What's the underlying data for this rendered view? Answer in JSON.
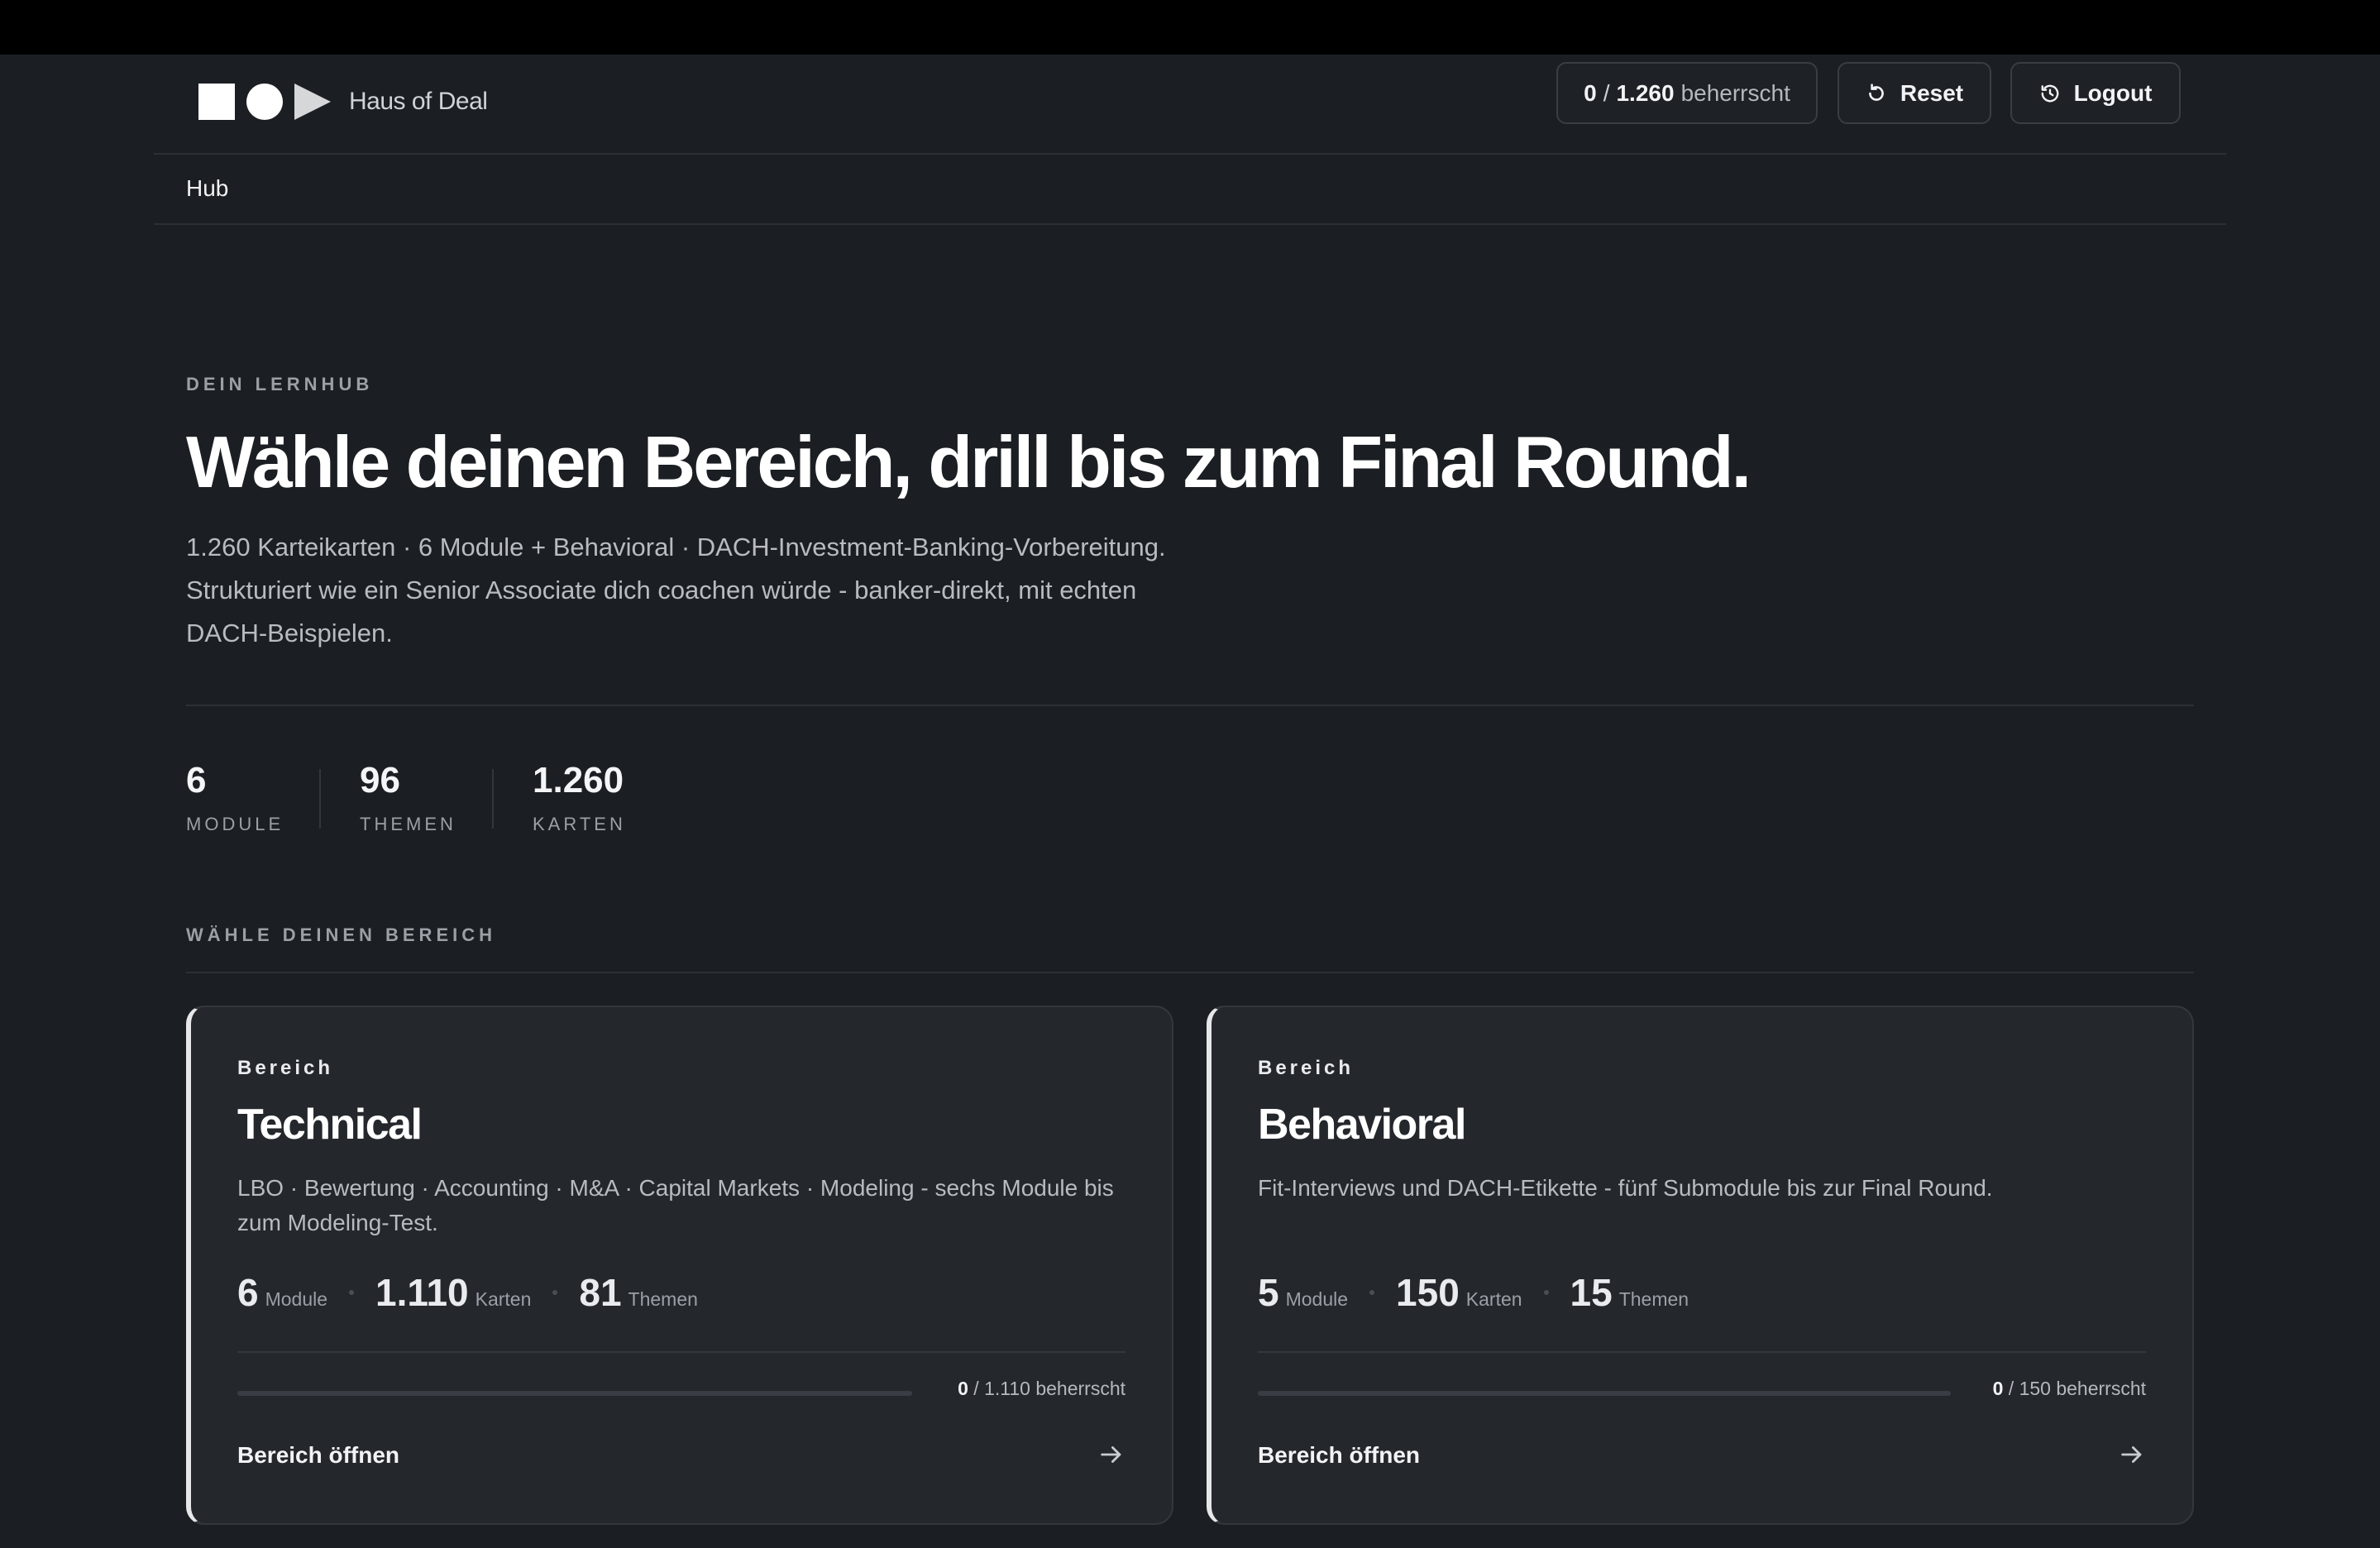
{
  "app": {
    "name": "Haus of Deal",
    "mastery": {
      "current": "0",
      "separator": "/",
      "total": "1.260",
      "suffix": "beherrscht"
    },
    "reset_label": "Reset",
    "logout_label": "Logout"
  },
  "nav": {
    "hub_label": "Hub"
  },
  "hero": {
    "eyebrow": "DEIN LERNHUB",
    "title": "Wähle deinen Bereich, drill bis zum Final Round.",
    "description_lines": [
      "1.260 Karteikarten · 6 Module + Behavioral · DACH-Investment-Banking-Vorbereitung.",
      "Strukturiert wie ein Senior Associate dich coachen würde - banker-direkt, mit echten",
      "DACH-Beispielen."
    ]
  },
  "stats": [
    {
      "value": "6",
      "label": "MODULE"
    },
    {
      "value": "96",
      "label": "THEMEN"
    },
    {
      "value": "1.260",
      "label": "KARTEN"
    }
  ],
  "section": {
    "label": "WÄHLE DEINEN BEREICH"
  },
  "cards": [
    {
      "kicker": "Bereich",
      "title": "Technical",
      "description": "LBO · Bewertung · Accounting · M&A · Capital Markets · Modeling - sechs Module bis zum Modeling-Test.",
      "metrics": [
        {
          "value": "6",
          "unit": "Module"
        },
        {
          "value": "1.110",
          "unit": "Karten"
        },
        {
          "value": "81",
          "unit": "Themen"
        }
      ],
      "progress": {
        "mastered": "0",
        "total": "1.110",
        "suffix": "beherrscht",
        "fraction": 0
      },
      "open_label": "Bereich öffnen"
    },
    {
      "kicker": "Bereich",
      "title": "Behavioral",
      "description": "Fit-Interviews und DACH-Etikette - fünf Submodule bis zur Final Round.",
      "metrics": [
        {
          "value": "5",
          "unit": "Module"
        },
        {
          "value": "150",
          "unit": "Karten"
        },
        {
          "value": "15",
          "unit": "Themen"
        }
      ],
      "progress": {
        "mastered": "0",
        "total": "150",
        "suffix": "beherrscht",
        "fraction": 0
      },
      "open_label": "Bereich öffnen"
    }
  ],
  "icons": {
    "logo": [
      "square-icon",
      "circle-icon",
      "play-triangle-icon"
    ],
    "reset": "rotate-ccw-icon",
    "logout": "history-icon",
    "open": "arrow-right-icon"
  },
  "colors": {
    "background": "#1b1e22",
    "card": "#24272c",
    "accent": "#e6e7e9"
  }
}
